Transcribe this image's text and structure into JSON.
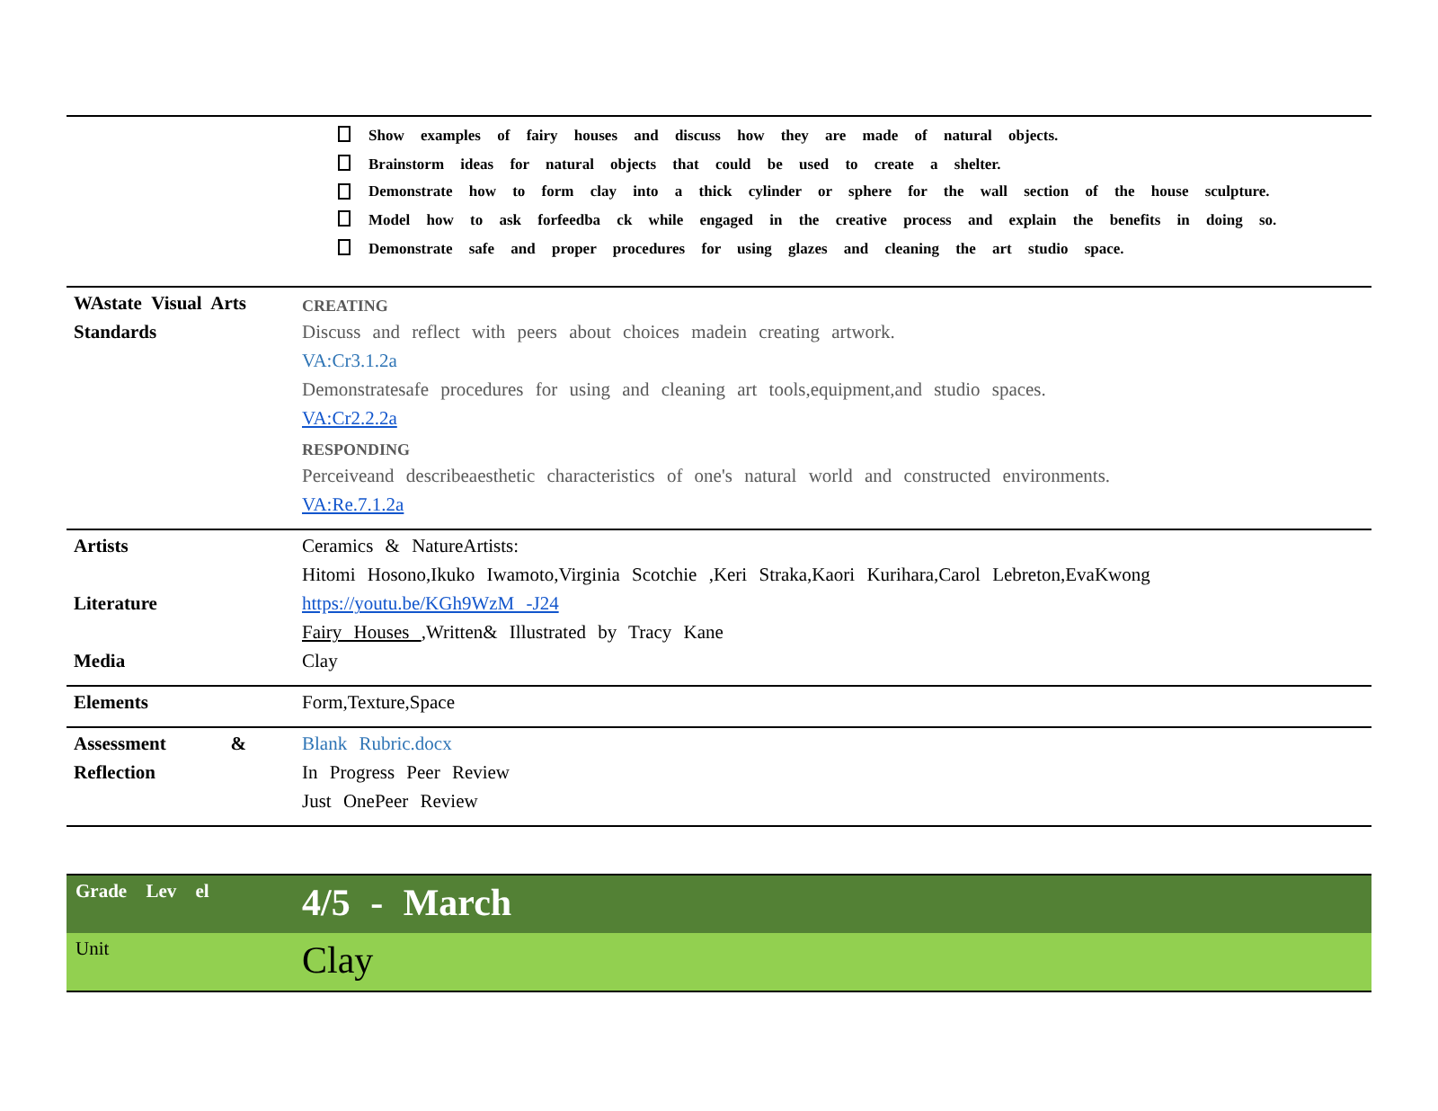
{
  "activities": [
    "Show examples of fairy houses and discuss how they are made of natural objects.",
    "Brainstorm ideas for natural objects that could be used to create a shelter.",
    "Demonstrate how to form clay into a thick cylinder or sphere for the wall section of the house sculpture.",
    "Model how to ask forfeedba ck while engaged in the creative process and explain the benefits in doing so.",
    "Demonstrate safe and proper procedures for using glazes and cleaning the art studio space."
  ],
  "rows": [
    {
      "label": "WAstate Visual Arts Standards",
      "lines": [
        {
          "kind": "heading",
          "text": "CREATING"
        },
        {
          "kind": "text",
          "text": "Discuss and reflect with peers about choices madein creating artwork."
        },
        {
          "kind": "code",
          "text": "VA:Cr3.1.2a"
        },
        {
          "kind": "text",
          "text": "Demonstratesafe procedures for using and cleaning art tools,equipment,and studio spaces."
        },
        {
          "kind": "link",
          "text": "VA:Cr2.2.2a"
        },
        {
          "kind": "heading",
          "text": "RESPONDING"
        },
        {
          "kind": "text",
          "text": "Perceiveand describeaesthetic characteristics of one's natural world and constructed environments."
        },
        {
          "kind": "link",
          "text": "VA:Re.7.1.2a"
        }
      ]
    },
    {
      "lines": [
        {
          "kind": "plain",
          "label": "Artists",
          "text": "Ceramics & NatureArtists:"
        },
        {
          "kind": "plain",
          "text": "Hitomi Hosono,Ikuko Iwamoto,Virginia Scotchie ,Keri Straka,Kaori Kurihara,Carol Lebreton,EvaKwong"
        },
        {
          "kind": "link",
          "label": "Literature",
          "text": "https://youtu.be/KGh9WzM -J24"
        },
        {
          "kind": "book",
          "title": "Fairy Houses ",
          "text": ",Written& Illustrated by Tracy Kane"
        },
        {
          "kind": "plain",
          "label": "Media",
          "text": "Clay"
        }
      ]
    },
    {
      "label": "Elements",
      "lines": [
        {
          "kind": "plain",
          "text": "Form,Texture,Space"
        }
      ]
    },
    {
      "label": "Assessment & Reflection",
      "lines": [
        {
          "kind": "code",
          "text": "Blank Rubric.docx"
        },
        {
          "kind": "plain",
          "text": "In Progress Peer Review"
        },
        {
          "kind": "plain",
          "text": "Just OnePeer Review"
        }
      ]
    }
  ],
  "summary": [
    {
      "kind": "dark",
      "label": "Grade Lev el",
      "value": "4/5 - March"
    },
    {
      "kind": "light",
      "label": "Unit",
      "value": "Clay"
    }
  ]
}
